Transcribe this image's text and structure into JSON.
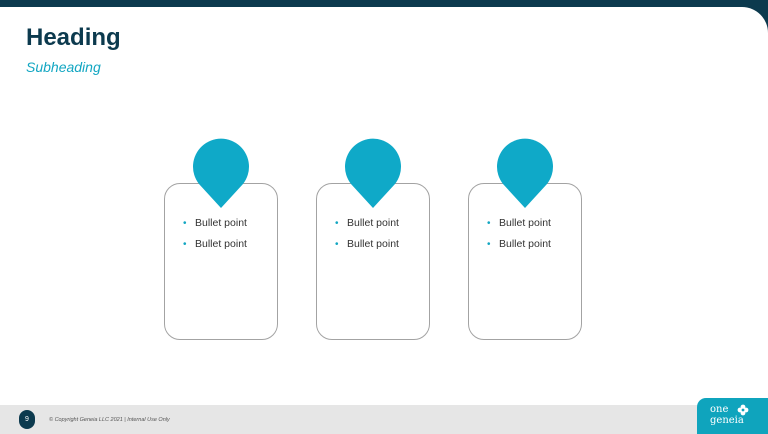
{
  "slide": {
    "heading": "Heading",
    "subheading": "Subheading"
  },
  "cards": [
    {
      "bullets": [
        "Bullet point",
        "Bullet point"
      ]
    },
    {
      "bullets": [
        "Bullet point",
        "Bullet point"
      ]
    },
    {
      "bullets": [
        "Bullet point",
        "Bullet point"
      ]
    }
  ],
  "footer": {
    "page_number": "9",
    "copyright": "© Copyright Geneia LLC 2021  |  Internal Use Only",
    "logo_word1": "one",
    "logo_word2": "geneia"
  },
  "colors": {
    "navy": "#0c3a4e",
    "teal": "#12a6c2",
    "pin": "#0fa9c8"
  },
  "icons": {
    "bullet": "•",
    "pin": "map-pin-icon",
    "logo_mark": "flower-icon"
  }
}
